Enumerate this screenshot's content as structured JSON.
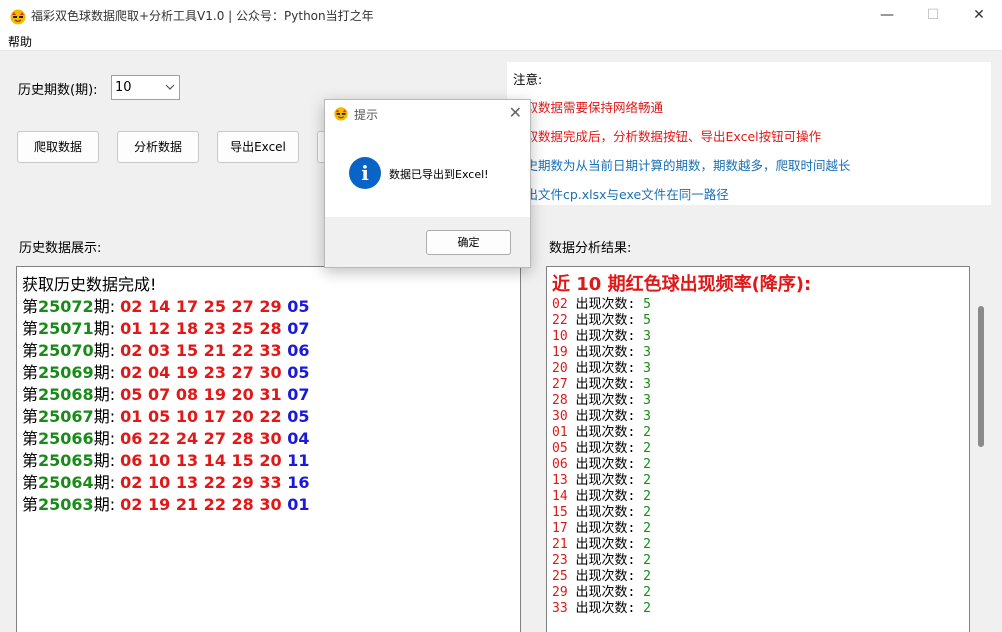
{
  "window": {
    "title": "福彩双色球数据爬取+分析工具V1.0 | 公众号：Python当打之年",
    "minimize_glyph": "—",
    "maximize_glyph": "☐",
    "close_glyph": "✕"
  },
  "menu": {
    "help": "帮助"
  },
  "controls": {
    "history_label": "历史期数(期):",
    "history_value": "10",
    "crawl_button": "爬取数据",
    "analyze_button": "分析数据",
    "export_button": "导出Excel"
  },
  "notes": {
    "title": "注意:",
    "items": [
      {
        "text": "爬取数据需要保持网络畅通",
        "color": "#e01818"
      },
      {
        "text": "爬取数据完成后，分析数据按钮、导出Excel按钮可操作",
        "color": "#e01818"
      },
      {
        "text": "历史期数为从当前日期计算的期数，期数越多，爬取时间越长",
        "color": "#1a6fb5"
      },
      {
        "text": "导出文件cp.xlsx与exe文件在同一路径",
        "color": "#1a6fb5"
      }
    ]
  },
  "history": {
    "label": "历史数据展示:",
    "heading": "获取历史数据完成!",
    "prefix": "第",
    "suffix": "期: ",
    "rows": [
      {
        "issue": "25072",
        "reds": "02 14 17 25 27 29",
        "blue": "05"
      },
      {
        "issue": "25071",
        "reds": "01 12 18 23 25 28",
        "blue": "07"
      },
      {
        "issue": "25070",
        "reds": "02 03 15 21 22 33",
        "blue": "06"
      },
      {
        "issue": "25069",
        "reds": "02 04 19 23 27 30",
        "blue": "05"
      },
      {
        "issue": "25068",
        "reds": "05 07 08 19 20 31",
        "blue": "07"
      },
      {
        "issue": "25067",
        "reds": "01 05 10 17 20 22",
        "blue": "05"
      },
      {
        "issue": "25066",
        "reds": "06 22 24 27 28 30",
        "blue": "04"
      },
      {
        "issue": "25065",
        "reds": "06 10 13 14 15 20",
        "blue": "11"
      },
      {
        "issue": "25064",
        "reds": "02 10 13 22 29 33",
        "blue": "16"
      },
      {
        "issue": "25063",
        "reds": "02 19 21 22 28 30",
        "blue": "01"
      }
    ]
  },
  "analysis": {
    "label": "数据分析结果:",
    "heading": "近 10 期红色球出现频率(降序):",
    "count_label": "出现次数:",
    "rows": [
      {
        "num": "02",
        "count": "5"
      },
      {
        "num": "22",
        "count": "5"
      },
      {
        "num": "10",
        "count": "3"
      },
      {
        "num": "19",
        "count": "3"
      },
      {
        "num": "20",
        "count": "3"
      },
      {
        "num": "27",
        "count": "3"
      },
      {
        "num": "28",
        "count": "3"
      },
      {
        "num": "30",
        "count": "3"
      },
      {
        "num": "01",
        "count": "2"
      },
      {
        "num": "05",
        "count": "2"
      },
      {
        "num": "06",
        "count": "2"
      },
      {
        "num": "13",
        "count": "2"
      },
      {
        "num": "14",
        "count": "2"
      },
      {
        "num": "15",
        "count": "2"
      },
      {
        "num": "17",
        "count": "2"
      },
      {
        "num": "21",
        "count": "2"
      },
      {
        "num": "23",
        "count": "2"
      },
      {
        "num": "25",
        "count": "2"
      },
      {
        "num": "29",
        "count": "2"
      },
      {
        "num": "33",
        "count": "2"
      }
    ]
  },
  "dialog": {
    "title": "提示",
    "info_glyph": "i",
    "message": "数据已导出到Excel!",
    "ok_button": "确定",
    "close_glyph": "✕"
  },
  "colors": {
    "red": "#e01818",
    "blue": "#1a1ad8",
    "green": "#1a8a1a",
    "info": "#0a64c8"
  }
}
